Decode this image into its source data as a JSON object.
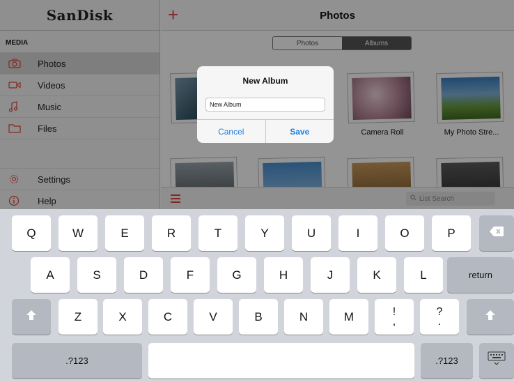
{
  "sidebar": {
    "logo": "SanDisk",
    "section_label": "MEDIA",
    "items": [
      {
        "label": "Photos",
        "icon": "camera-icon"
      },
      {
        "label": "Videos",
        "icon": "video-camera-icon"
      },
      {
        "label": "Music",
        "icon": "music-note-icon"
      },
      {
        "label": "Files",
        "icon": "folder-icon"
      }
    ],
    "bottom_items": [
      {
        "label": "Settings",
        "icon": "gear-icon"
      },
      {
        "label": "Help",
        "icon": "info-icon"
      }
    ]
  },
  "header": {
    "add_button": "+",
    "title": "Photos"
  },
  "segmented": {
    "photos": "Photos",
    "albums": "Albums"
  },
  "albums": [
    {
      "name": "Ne"
    },
    {
      "name": ""
    },
    {
      "name": "Camera Roll"
    },
    {
      "name": "My Photo Stre..."
    }
  ],
  "search": {
    "placeholder": "List Search"
  },
  "modal": {
    "title": "New Album",
    "input_value": "New Album",
    "cancel": "Cancel",
    "save": "Save"
  },
  "keyboard": {
    "row1": [
      "Q",
      "W",
      "E",
      "R",
      "T",
      "Y",
      "U",
      "I",
      "O",
      "P"
    ],
    "row2": [
      "A",
      "S",
      "D",
      "F",
      "G",
      "H",
      "J",
      "K",
      "L"
    ],
    "row3": [
      "Z",
      "X",
      "C",
      "V",
      "B",
      "N",
      "M"
    ],
    "punct1": [
      "!",
      ","
    ],
    "punct2": [
      "?",
      "."
    ],
    "return": "return",
    "numbers_left": ".?123",
    "numbers_right": ".?123"
  },
  "colors": {
    "accent_red": "#e0443c",
    "link_blue": "#1e7fdd",
    "keyboard_bg": "#d1d5db"
  }
}
